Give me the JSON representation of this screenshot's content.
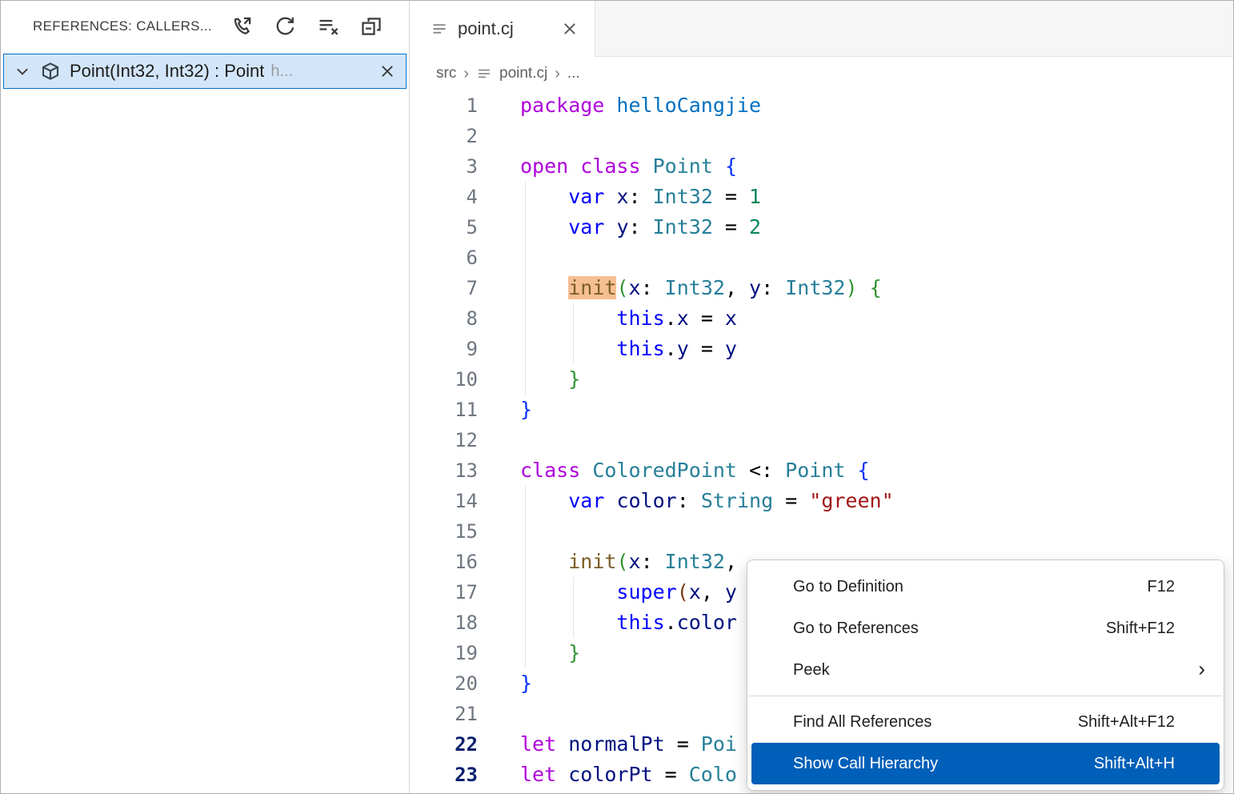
{
  "colors": {
    "menu_highlight": "#005fb8",
    "tree_selection_bg": "#d3e6f9",
    "tree_selection_border": "#0270c8",
    "init_occurrence_highlight": "#f6be93",
    "keyword_blue": "#0000ff",
    "keyword_magenta": "#af00db",
    "type_teal": "#267f99",
    "variable_navy": "#001080",
    "number_green": "#098658",
    "string_red": "#a31515",
    "function_brown": "#795e26"
  },
  "panel": {
    "title": "REFERENCES: CALLERS...",
    "action_icons": [
      "call-hierarchy-icon",
      "refresh-icon",
      "clear-results-icon",
      "collapse-all-icon"
    ],
    "tree_item": {
      "label": "Point(Int32, Int32) : Point",
      "suffix": "h...",
      "icons": [
        "chevron-down-icon",
        "symbol-cube-icon",
        "close-icon"
      ]
    }
  },
  "editor": {
    "tab": {
      "label": "point.cj",
      "icons": [
        "file-icon",
        "close-icon"
      ]
    },
    "breadcrumb": {
      "items": [
        "src",
        "point.cj",
        "..."
      ]
    },
    "code": {
      "lines": [
        {
          "n": "1",
          "tokens": [
            {
              "t": "package",
              "c": "m"
            },
            {
              "t": " ",
              "c": "p"
            },
            {
              "t": "helloCangjie",
              "c": "ns"
            }
          ]
        },
        {
          "n": "2",
          "tokens": []
        },
        {
          "n": "3",
          "tokens": [
            {
              "t": "open",
              "c": "m"
            },
            {
              "t": " ",
              "c": "p"
            },
            {
              "t": "class",
              "c": "m"
            },
            {
              "t": " ",
              "c": "p"
            },
            {
              "t": "Point",
              "c": "t"
            },
            {
              "t": " ",
              "c": "p"
            },
            {
              "t": "{",
              "c": "b1"
            }
          ]
        },
        {
          "n": "4",
          "tokens": [
            {
              "t": "    ",
              "c": "p"
            },
            {
              "t": "var",
              "c": "k"
            },
            {
              "t": " ",
              "c": "p"
            },
            {
              "t": "x",
              "c": "v"
            },
            {
              "t": ": ",
              "c": "p"
            },
            {
              "t": "Int32",
              "c": "t"
            },
            {
              "t": " = ",
              "c": "p"
            },
            {
              "t": "1",
              "c": "n"
            }
          ]
        },
        {
          "n": "5",
          "tokens": [
            {
              "t": "    ",
              "c": "p"
            },
            {
              "t": "var",
              "c": "k"
            },
            {
              "t": " ",
              "c": "p"
            },
            {
              "t": "y",
              "c": "v"
            },
            {
              "t": ": ",
              "c": "p"
            },
            {
              "t": "Int32",
              "c": "t"
            },
            {
              "t": " = ",
              "c": "p"
            },
            {
              "t": "2",
              "c": "n"
            }
          ]
        },
        {
          "n": "6",
          "tokens": []
        },
        {
          "n": "7",
          "tokens": [
            {
              "t": "    ",
              "c": "p"
            },
            {
              "t": "init",
              "c": "f",
              "h": true
            },
            {
              "t": "(",
              "c": "b2"
            },
            {
              "t": "x",
              "c": "v"
            },
            {
              "t": ": ",
              "c": "p"
            },
            {
              "t": "Int32",
              "c": "t"
            },
            {
              "t": ", ",
              "c": "p"
            },
            {
              "t": "y",
              "c": "v"
            },
            {
              "t": ": ",
              "c": "p"
            },
            {
              "t": "Int32",
              "c": "t"
            },
            {
              "t": ")",
              "c": "b2"
            },
            {
              "t": " ",
              "c": "p"
            },
            {
              "t": "{",
              "c": "b2"
            }
          ]
        },
        {
          "n": "8",
          "tokens": [
            {
              "t": "        ",
              "c": "p"
            },
            {
              "t": "this",
              "c": "k"
            },
            {
              "t": ".",
              "c": "p"
            },
            {
              "t": "x",
              "c": "v"
            },
            {
              "t": " = ",
              "c": "p"
            },
            {
              "t": "x",
              "c": "v"
            }
          ]
        },
        {
          "n": "9",
          "tokens": [
            {
              "t": "        ",
              "c": "p"
            },
            {
              "t": "this",
              "c": "k"
            },
            {
              "t": ".",
              "c": "p"
            },
            {
              "t": "y",
              "c": "v"
            },
            {
              "t": " = ",
              "c": "p"
            },
            {
              "t": "y",
              "c": "v"
            }
          ]
        },
        {
          "n": "10",
          "tokens": [
            {
              "t": "    ",
              "c": "p"
            },
            {
              "t": "}",
              "c": "b2"
            }
          ]
        },
        {
          "n": "11",
          "tokens": [
            {
              "t": "}",
              "c": "b1"
            }
          ]
        },
        {
          "n": "12",
          "tokens": []
        },
        {
          "n": "13",
          "tokens": [
            {
              "t": "class",
              "c": "m"
            },
            {
              "t": " ",
              "c": "p"
            },
            {
              "t": "ColoredPoint",
              "c": "t"
            },
            {
              "t": " <: ",
              "c": "p"
            },
            {
              "t": "Point",
              "c": "t"
            },
            {
              "t": " ",
              "c": "p"
            },
            {
              "t": "{",
              "c": "b1"
            }
          ]
        },
        {
          "n": "14",
          "tokens": [
            {
              "t": "    ",
              "c": "p"
            },
            {
              "t": "var",
              "c": "k"
            },
            {
              "t": " ",
              "c": "p"
            },
            {
              "t": "color",
              "c": "v"
            },
            {
              "t": ": ",
              "c": "p"
            },
            {
              "t": "String",
              "c": "t"
            },
            {
              "t": " = ",
              "c": "p"
            },
            {
              "t": "\"green\"",
              "c": "s"
            }
          ]
        },
        {
          "n": "15",
          "tokens": []
        },
        {
          "n": "16",
          "tokens": [
            {
              "t": "    ",
              "c": "p"
            },
            {
              "t": "init",
              "c": "f"
            },
            {
              "t": "(",
              "c": "b2"
            },
            {
              "t": "x",
              "c": "v"
            },
            {
              "t": ": ",
              "c": "p"
            },
            {
              "t": "Int32",
              "c": "t"
            },
            {
              "t": ",",
              "c": "p"
            }
          ]
        },
        {
          "n": "17",
          "tokens": [
            {
              "t": "        ",
              "c": "p"
            },
            {
              "t": "super",
              "c": "k"
            },
            {
              "t": "(",
              "c": "b3"
            },
            {
              "t": "x",
              "c": "v"
            },
            {
              "t": ", ",
              "c": "p"
            },
            {
              "t": "y",
              "c": "v"
            }
          ]
        },
        {
          "n": "18",
          "tokens": [
            {
              "t": "        ",
              "c": "p"
            },
            {
              "t": "this",
              "c": "k"
            },
            {
              "t": ".",
              "c": "p"
            },
            {
              "t": "color",
              "c": "v"
            }
          ]
        },
        {
          "n": "19",
          "tokens": [
            {
              "t": "    ",
              "c": "p"
            },
            {
              "t": "}",
              "c": "b2"
            }
          ]
        },
        {
          "n": "20",
          "tokens": [
            {
              "t": "}",
              "c": "b1"
            }
          ]
        },
        {
          "n": "21",
          "tokens": []
        },
        {
          "n": "22",
          "em": true,
          "tokens": [
            {
              "t": "let",
              "c": "m"
            },
            {
              "t": " ",
              "c": "p"
            },
            {
              "t": "normalPt",
              "c": "v"
            },
            {
              "t": " = ",
              "c": "p"
            },
            {
              "t": "Poi",
              "c": "t"
            }
          ]
        },
        {
          "n": "23",
          "em": true,
          "tokens": [
            {
              "t": "let",
              "c": "m"
            },
            {
              "t": " ",
              "c": "p"
            },
            {
              "t": "colorPt",
              "c": "v"
            },
            {
              "t": " = ",
              "c": "p"
            },
            {
              "t": "Colo",
              "c": "t"
            }
          ]
        }
      ]
    }
  },
  "context_menu": {
    "items": [
      {
        "label": "Go to Definition",
        "shortcut": "F12"
      },
      {
        "label": "Go to References",
        "shortcut": "Shift+F12"
      },
      {
        "label": "Peek",
        "shortcut": "",
        "submenu": true
      },
      {
        "separator": true
      },
      {
        "label": "Find All References",
        "shortcut": "Shift+Alt+F12"
      },
      {
        "label": "Show Call Hierarchy",
        "shortcut": "Shift+Alt+H",
        "highlighted": true
      }
    ]
  }
}
